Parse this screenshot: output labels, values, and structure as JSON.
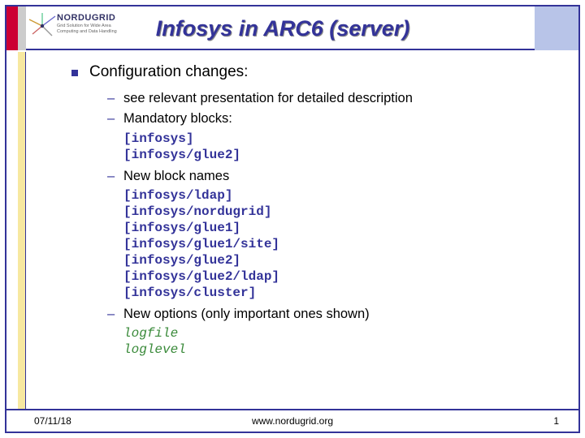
{
  "header": {
    "brand": "NORDUGRID",
    "tagline1": "Grid Solution for Wide Area",
    "tagline2": "Computing and Data Handling",
    "title": "Infosys in ARC6 (server)"
  },
  "content": {
    "lvl1": "Configuration changes:",
    "items": [
      {
        "text": "see relevant presentation for detailed description"
      },
      {
        "text": "Mandatory blocks:",
        "code": [
          "[infosys]",
          "[infosys/glue2]"
        ]
      },
      {
        "text": "New block names",
        "code": [
          "[infosys/ldap]",
          "[infosys/nordugrid]",
          "[infosys/glue1]",
          "[infosys/glue1/site]",
          "[infosys/glue2]",
          "[infosys/glue2/ldap]",
          "[infosys/cluster]"
        ]
      },
      {
        "text": "New options (only important ones shown)",
        "opts": [
          "logfile",
          "loglevel"
        ]
      }
    ]
  },
  "footer": {
    "date": "07/11/18",
    "url": "www.nordugrid.org",
    "page": "1"
  }
}
